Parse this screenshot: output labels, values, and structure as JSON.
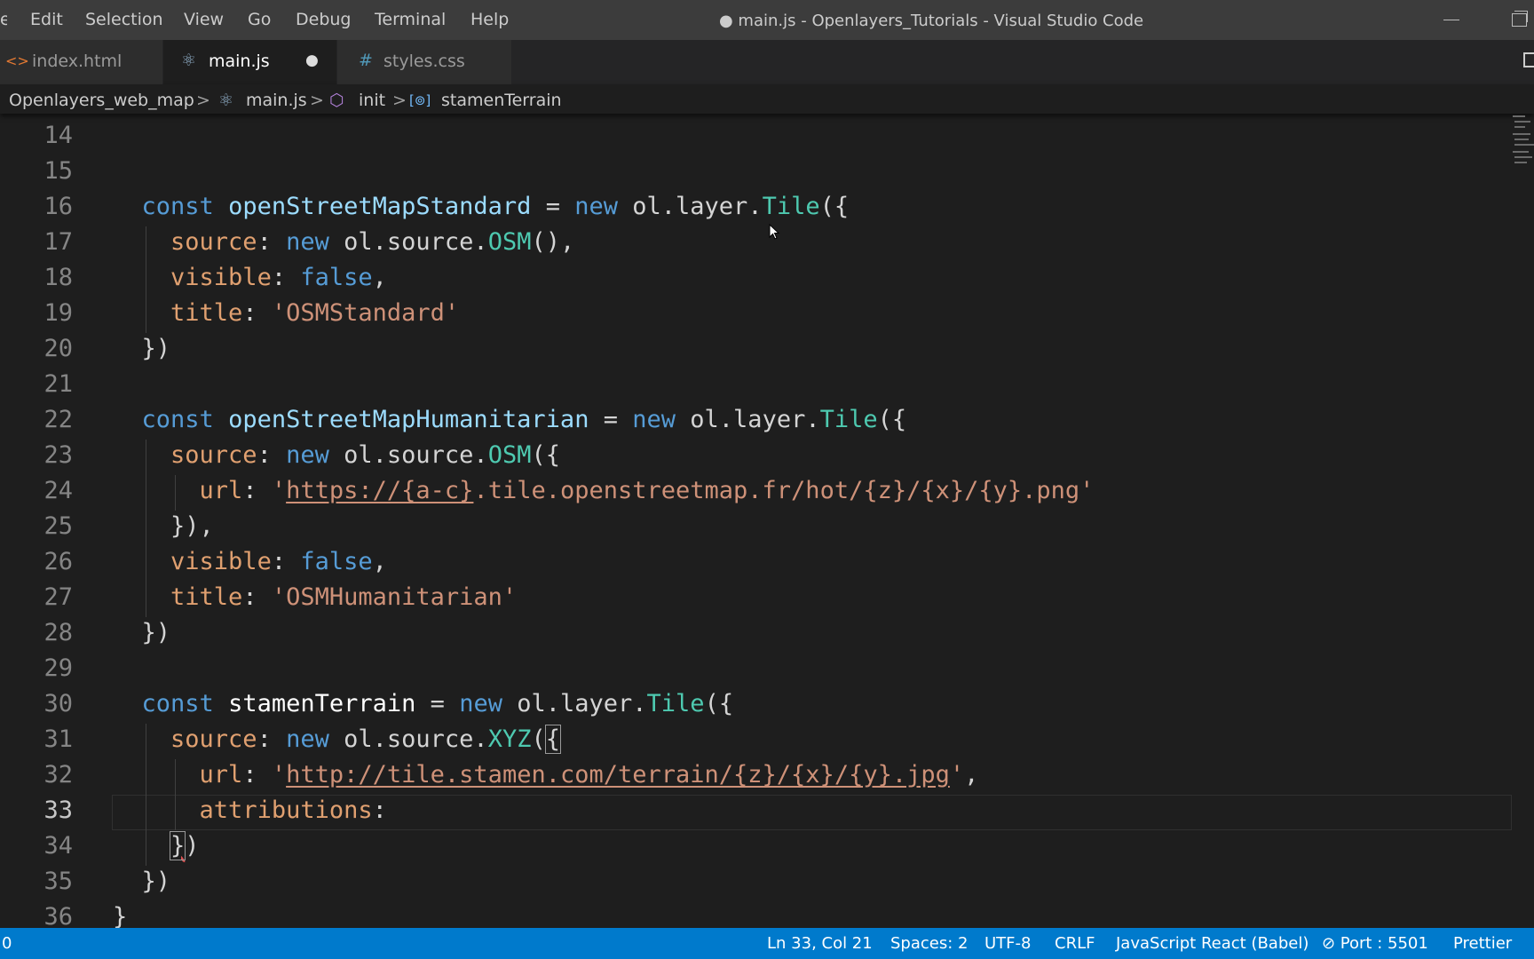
{
  "menu": {
    "items": [
      "Edit",
      "Selection",
      "View",
      "Go",
      "Debug",
      "Terminal",
      "Help"
    ],
    "partial_first": "e"
  },
  "window": {
    "title": "● main.js - Openlayers_Tutorials - Visual Studio Code"
  },
  "tabs": [
    {
      "icon": "<>",
      "icon_name": "html-file-icon",
      "label": "index.html",
      "active": false
    },
    {
      "icon": "⚛",
      "icon_name": "react-file-icon",
      "label": "main.js",
      "active": true,
      "dirty_marker": "●"
    },
    {
      "icon": "#",
      "icon_name": "css-file-icon",
      "label": "styles.css",
      "active": false
    }
  ],
  "breadcrumb": {
    "folder": "Openlayers_web_map",
    "file_icon": "⚛",
    "file": "main.js",
    "function_icon": "⬡",
    "function": "init",
    "variable_icon": "[⊚]",
    "variable": "stamenTerrain",
    "separator": ">"
  },
  "editor": {
    "line_numbers": [
      "14",
      "15",
      "16",
      "17",
      "18",
      "19",
      "20",
      "21",
      "22",
      "23",
      "24",
      "25",
      "26",
      "27",
      "28",
      "29",
      "30",
      "31",
      "32",
      "33",
      "34",
      "35",
      "36"
    ],
    "current_line": "33"
  },
  "statusbar": {
    "left": "0",
    "position": "Ln 33, Col 21",
    "spaces": "Spaces: 2",
    "encoding": "UTF-8",
    "eol": "CRLF",
    "language": "JavaScript React (Babel)",
    "port": "⊘ Port : 5501",
    "formatter": "Prettier"
  },
  "colors": {
    "statusbar": "#007acc",
    "keyword": "#569cd6",
    "string": "#ce9178",
    "class": "#4ec9b0",
    "variable": "#9cdcfe"
  }
}
